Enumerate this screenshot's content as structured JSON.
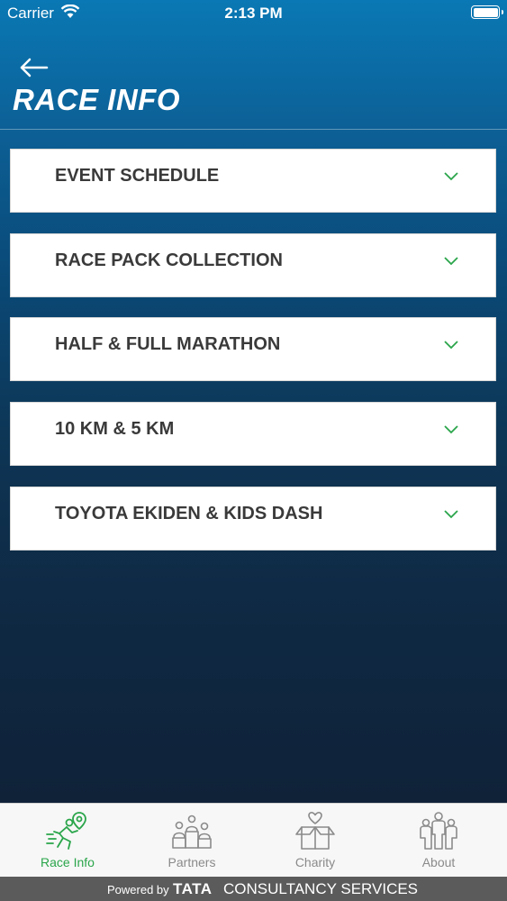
{
  "status_bar": {
    "carrier": "Carrier",
    "time": "2:13 PM"
  },
  "header": {
    "back_icon": "arrow-left-icon",
    "title": "RACE INFO"
  },
  "accordion": {
    "items": [
      {
        "label": "EVENT SCHEDULE"
      },
      {
        "label": "RACE PACK COLLECTION"
      },
      {
        "label": "HALF & FULL MARATHON"
      },
      {
        "label": "10 KM & 5 KM"
      },
      {
        "label": "TOYOTA EKIDEN & KIDS DASH"
      }
    ],
    "chevron_color": "#2aa54a"
  },
  "tab_bar": {
    "tabs": [
      {
        "label": "Race Info",
        "icon": "runner-icon",
        "active": true
      },
      {
        "label": "Partners",
        "icon": "podium-icon",
        "active": false
      },
      {
        "label": "Charity",
        "icon": "gift-box-icon",
        "active": false
      },
      {
        "label": "About",
        "icon": "people-icon",
        "active": false
      }
    ],
    "active_color": "#2aa54a"
  },
  "footer": {
    "powered_by": "Powered by",
    "brand": "TATA",
    "company": "CONSULTANCY SERVICES"
  }
}
